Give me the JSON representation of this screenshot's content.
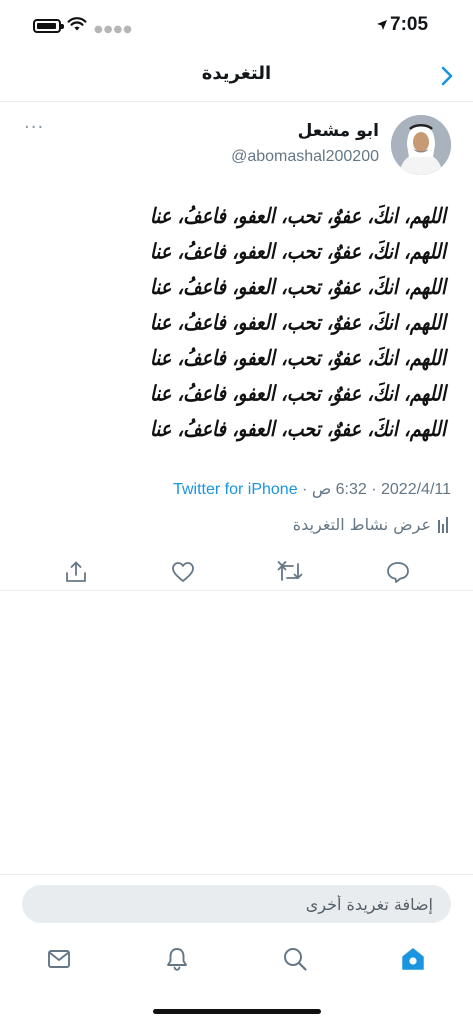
{
  "status_bar": {
    "time": "7:05"
  },
  "header": {
    "title": "التغريدة"
  },
  "tweet": {
    "author_name": "ابو مشعل",
    "author_handle": "@abomashal200200",
    "more_glyph": "···",
    "calligraphy_lines": [
      "اللهم، انكَ، عفوٌ، تحب، العفو، فاعفُ، عنا",
      "اللهم، انكَ، عفوٌ، تحب، العفو، فاعفُ، عنا",
      "اللهم، انكَ، عفوٌ، تحب، العفو، فاعفُ، عنا",
      "اللهم، انكَ، عفوٌ، تحب، العفو، فاعفُ، عنا",
      "اللهم، انكَ، عفوٌ، تحب، العفو، فاعفُ، عنا",
      "اللهم، انكَ، عفوٌ، تحب، العفو، فاعفُ، عنا",
      "اللهم، انكَ، عفوٌ، تحب، العفو، فاعفُ، عنا"
    ],
    "date": "2022/4/11",
    "time": "6:32 ص",
    "separator": "·",
    "source": "Twitter for iPhone",
    "activity_label": "عرض نشاط التغريدة"
  },
  "actions": {
    "icons": [
      "reply-icon",
      "retweet-icon",
      "like-icon",
      "share-icon"
    ]
  },
  "compose": {
    "placeholder": "إضافة تغريدة أخرى"
  },
  "tabs": {
    "icons": [
      "home-icon",
      "search-icon",
      "notifications-icon",
      "messages-icon"
    ],
    "active": "home-icon"
  },
  "colors": {
    "accent": "#1b95e0",
    "muted": "#657786",
    "divider": "#e6ecf0"
  }
}
